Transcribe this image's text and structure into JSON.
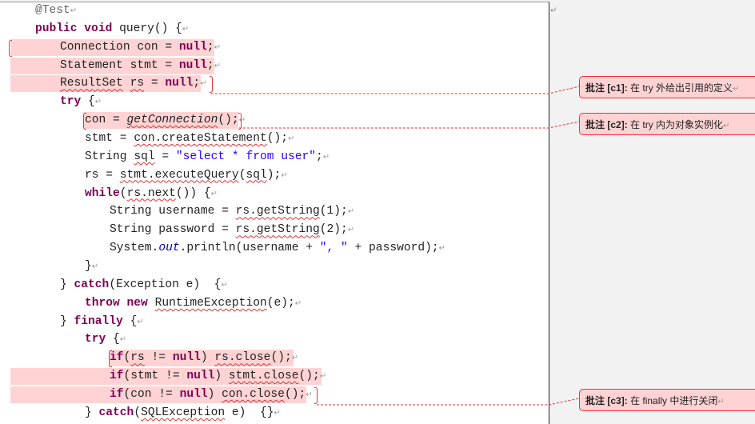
{
  "code_lines": [
    {
      "indent": 1,
      "segs": [
        [
          "@Test",
          "ann"
        ],
        [
          "↵",
          "pm"
        ]
      ]
    },
    {
      "indent": 1,
      "segs": [
        [
          "public void",
          "kw"
        ],
        [
          " query() {",
          ""
        ],
        [
          "↵",
          "pm"
        ]
      ]
    },
    {
      "indent": 2,
      "hl": [
        13,
        268
      ],
      "segs": [
        [
          "Connection con = ",
          ""
        ],
        [
          "null",
          "kw"
        ],
        [
          ";",
          ""
        ],
        [
          "↵",
          "pm"
        ]
      ]
    },
    {
      "indent": 2,
      "hl": [
        13,
        268
      ],
      "segs": [
        [
          "Statement stmt = ",
          ""
        ],
        [
          "null",
          "kw"
        ],
        [
          ";",
          ""
        ],
        [
          "↵",
          "pm"
        ]
      ]
    },
    {
      "indent": 2,
      "hl": [
        13,
        251
      ],
      "segs": [
        [
          "ResultSet",
          "sq"
        ],
        [
          " ",
          ""
        ],
        [
          "rs",
          "sq"
        ],
        [
          " = ",
          ""
        ],
        [
          "null",
          "kw"
        ],
        [
          ";",
          ""
        ],
        [
          "↵",
          "pm"
        ]
      ]
    },
    {
      "indent": 2,
      "segs": [
        [
          "try",
          "kw"
        ],
        [
          " {",
          ""
        ],
        [
          "↵",
          "pm"
        ]
      ]
    },
    {
      "indent": 3,
      "hl": [
        104,
        298
      ],
      "segs": [
        [
          "con = ",
          ""
        ],
        [
          "getConnection",
          "it sq"
        ],
        [
          "();",
          ""
        ],
        [
          "↵",
          "pm"
        ]
      ]
    },
    {
      "indent": 3,
      "segs": [
        [
          "stmt = ",
          ""
        ],
        [
          "con.createStatement",
          "sq"
        ],
        [
          "();",
          ""
        ],
        [
          "↵",
          "pm"
        ]
      ]
    },
    {
      "indent": 3,
      "segs": [
        [
          "String ",
          ""
        ],
        [
          "sql",
          "sq"
        ],
        [
          " = ",
          ""
        ],
        [
          "\"select * from user\"",
          "str"
        ],
        [
          ";",
          ""
        ],
        [
          "↵",
          "pm"
        ]
      ]
    },
    {
      "indent": 3,
      "segs": [
        [
          "rs = ",
          ""
        ],
        [
          "stmt.executeQuery",
          "sq"
        ],
        [
          "(",
          ""
        ],
        [
          "sql",
          "sq"
        ],
        [
          ");",
          ""
        ],
        [
          "↵",
          "pm"
        ]
      ]
    },
    {
      "indent": 3,
      "segs": [
        [
          "while",
          "kw"
        ],
        [
          "(",
          ""
        ],
        [
          "rs.next",
          "sq"
        ],
        [
          "()) {",
          ""
        ],
        [
          "↵",
          "pm"
        ]
      ]
    },
    {
      "indent": 4,
      "segs": [
        [
          "String username = ",
          ""
        ],
        [
          "rs.getString",
          "sq"
        ],
        [
          "(1);",
          ""
        ],
        [
          "↵",
          "pm"
        ]
      ]
    },
    {
      "indent": 4,
      "segs": [
        [
          "String password = ",
          ""
        ],
        [
          "rs.getString",
          "sq"
        ],
        [
          "(2);",
          ""
        ],
        [
          "↵",
          "pm"
        ]
      ]
    },
    {
      "indent": 4,
      "segs": [
        [
          "System.",
          ""
        ],
        [
          "out",
          "fld"
        ],
        [
          ".println(username + ",
          ""
        ],
        [
          "\", \"",
          "str"
        ],
        [
          " + password);",
          ""
        ],
        [
          "↵",
          "pm"
        ]
      ]
    },
    {
      "indent": 3,
      "segs": [
        [
          "}",
          ""
        ],
        [
          "↵",
          "pm"
        ]
      ]
    },
    {
      "indent": 2,
      "segs": [
        [
          "} ",
          ""
        ],
        [
          "catch",
          "kw"
        ],
        [
          "(Exception e)  {",
          ""
        ],
        [
          "↵",
          "pm"
        ]
      ]
    },
    {
      "indent": 3,
      "segs": [
        [
          "throw new",
          "kw"
        ],
        [
          " ",
          ""
        ],
        [
          "RuntimeException",
          "sq"
        ],
        [
          "(e);",
          ""
        ],
        [
          "↵",
          "pm"
        ]
      ]
    },
    {
      "indent": 2,
      "segs": [
        [
          "} ",
          ""
        ],
        [
          "finally",
          "kw"
        ],
        [
          " {",
          ""
        ],
        [
          "↵",
          "pm"
        ]
      ]
    },
    {
      "indent": 3,
      "segs": [
        [
          "try",
          "kw"
        ],
        [
          " {",
          ""
        ],
        [
          "↵",
          "pm"
        ]
      ]
    },
    {
      "indent": 4,
      "hl": [
        136,
        367
      ],
      "segs": [
        [
          "if",
          "kw"
        ],
        [
          "(",
          ""
        ],
        [
          "rs",
          "sq"
        ],
        [
          " != ",
          ""
        ],
        [
          "null",
          "kw"
        ],
        [
          ") ",
          ""
        ],
        [
          "rs.close",
          "sq"
        ],
        [
          "();",
          ""
        ],
        [
          "↵",
          "pm"
        ]
      ]
    },
    {
      "indent": 4,
      "hl": [
        13,
        402
      ],
      "segs": [
        [
          "if",
          "kw"
        ],
        [
          "(stmt != ",
          ""
        ],
        [
          "null",
          "kw"
        ],
        [
          ") ",
          ""
        ],
        [
          "stmt.close",
          "sq"
        ],
        [
          "();",
          ""
        ],
        [
          "↵",
          "pm"
        ]
      ]
    },
    {
      "indent": 4,
      "hl": [
        13,
        383
      ],
      "segs": [
        [
          "if",
          "kw"
        ],
        [
          "(con != ",
          ""
        ],
        [
          "null",
          "kw"
        ],
        [
          ") ",
          ""
        ],
        [
          "con.close",
          "sq"
        ],
        [
          "();",
          ""
        ],
        [
          "↵",
          "pm"
        ]
      ]
    },
    {
      "indent": 3,
      "segs": [
        [
          "} ",
          ""
        ],
        [
          "catch",
          "kw"
        ],
        [
          "(",
          ""
        ],
        [
          "SQLException",
          "sq"
        ],
        [
          " e)  {}",
          ""
        ],
        [
          "↵",
          "pm"
        ]
      ]
    }
  ],
  "comments": [
    {
      "label": "批注",
      "id": "[c1]:",
      "text": " 在 try 外给出引用的定义",
      "mark": "↵"
    },
    {
      "label": "批注",
      "id": "[c2]:",
      "text": " 在 try 内为对象实例化",
      "mark": "↵"
    },
    {
      "label": "批注",
      "id": "[c3]:",
      "text": " 在 finally 中进行关闭",
      "mark": "↵"
    }
  ],
  "margin_mark": "↵",
  "colors": {
    "highlight": "#ffd3d3",
    "comment_border": "#ee3333",
    "keyword": "#7f0055",
    "string": "#2a00ff"
  }
}
